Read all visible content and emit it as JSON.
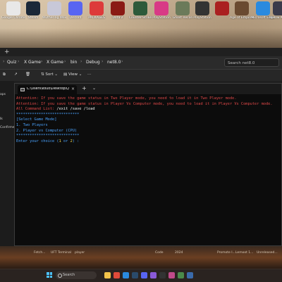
{
  "desktop": {
    "icons": [
      {
        "label": "Google Chrome",
        "icon": "chrome-icon",
        "color": "#e8e8e8"
      },
      {
        "label": "Steam",
        "icon": "steam-icon",
        "color": "#1b2838"
      },
      {
        "label": "Wuthering Waves",
        "icon": "wuthering-waves-icon",
        "color": "#c8c8d8"
      },
      {
        "label": "Discord",
        "icon": "discord-icon",
        "color": "#5865f2"
      },
      {
        "label": "PACKAGES",
        "icon": "packages-icon",
        "color": "#dd3a3a"
      },
      {
        "label": "Dota 2",
        "icon": "dota2-icon",
        "color": "#8a1a14"
      },
      {
        "label": "Counter-Strike",
        "icon": "counter-strike-icon",
        "color": "#2d5a3a"
      },
      {
        "label": "PlayStation",
        "icon": "playstation-icon",
        "color": "#d83a86"
      },
      {
        "label": "Ghost Recon",
        "icon": "ghost-recon-icon",
        "color": "#6b7a5a"
      },
      {
        "label": "PlayStation",
        "icon": "playstation-2-icon",
        "color": "#333333"
      },
      {
        "label": "",
        "icon": "game-icon",
        "color": "#aa2020"
      },
      {
        "label": "Age of Empires",
        "icon": "age-of-empires-icon",
        "color": "#6a4a30"
      },
      {
        "label": "Microsoft Edge",
        "icon": "edge-icon",
        "color": "#2a8adf"
      },
      {
        "label": "Hollow Knight",
        "icon": "hollow-knight-icon",
        "color": "#3a3a4a"
      }
    ]
  },
  "explorer": {
    "new_tab": "+",
    "breadcrumbs": [
      "Quiz",
      "X Game",
      "X Game",
      "bin",
      "Debug",
      "net8.0"
    ],
    "search_placeholder": "Search net8.0",
    "toolbar": {
      "sort": "Sort",
      "view": "View",
      "more": "···"
    },
    "sidebar_labels": [
      "aps",
      "lk",
      "Confirmed"
    ]
  },
  "terminal": {
    "tab_title": "C:\\Users\\kouo\\Desktop\\Quiz\\",
    "close": "×",
    "new_tab": "+",
    "dropdown": "⌄",
    "lines": {
      "attention1": "Attention: If you save the game status in Two Player mode, you need to load it in Two Player mode.",
      "attention2": "Attention: If you save the game status in Player Vs Computer mode, you need to load it in Player Vs Computer mode.",
      "commands_label": "All Command List: ",
      "commands": "/exit /save /load",
      "divider1": "****************************",
      "select_mode": "[Select Game Mode]",
      "option1": "1. Two Players",
      "option2": "2. Player vs Computer (CPU)",
      "divider2": "****************************",
      "prompt_start": "Enter your choice (",
      "choice1": "1",
      "prompt_or": " or ",
      "choice2": "2",
      "prompt_end": ") :"
    }
  },
  "background_captions": [
    "Fetch...",
    "UFT Terminal",
    "player",
    "Code",
    "2024",
    "Promote I...",
    "Lemoot 1...",
    "Unreleased..."
  ],
  "taskbar": {
    "search_placeholder": "Search",
    "apps": [
      {
        "icon": "file-explorer-icon",
        "color": "#f3c34a"
      },
      {
        "icon": "chrome-taskbar-icon",
        "color": "#e04a3a"
      },
      {
        "icon": "edge-taskbar-icon",
        "color": "#2a8adf"
      },
      {
        "icon": "steam-taskbar-icon",
        "color": "#2a4a6a"
      },
      {
        "icon": "discord-taskbar-icon",
        "color": "#5865f2"
      },
      {
        "icon": "visual-studio-icon",
        "color": "#8a5ad8"
      },
      {
        "icon": "terminal-taskbar-icon",
        "color": "#333333"
      },
      {
        "icon": "app-taskbar-icon",
        "color": "#c04a8a"
      },
      {
        "icon": "game-taskbar-icon",
        "color": "#4a8a4a"
      },
      {
        "icon": "app2-taskbar-icon",
        "color": "#3a6aaa"
      }
    ]
  }
}
